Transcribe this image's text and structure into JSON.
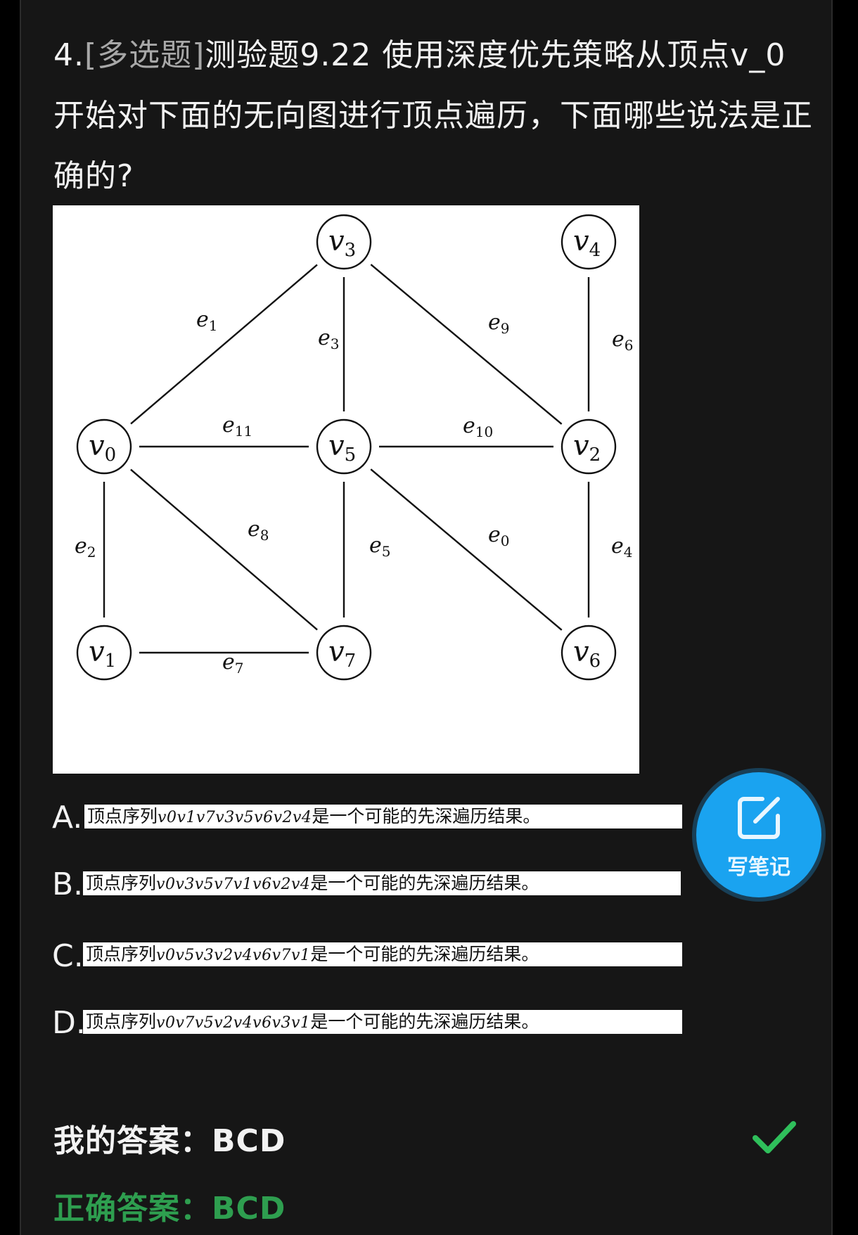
{
  "question": {
    "number": "4.",
    "type": "[多选题]",
    "text": "测验题9.22 使用深度优先策略从顶点v_0开始对下面的无向图进行顶点遍历，下面哪些说法是正确的?"
  },
  "graph": {
    "vertices": [
      "v0",
      "v1",
      "v2",
      "v3",
      "v4",
      "v5",
      "v6",
      "v7"
    ],
    "edges": [
      {
        "label": "e0",
        "from": "v5",
        "to": "v6"
      },
      {
        "label": "e1",
        "from": "v0",
        "to": "v3"
      },
      {
        "label": "e2",
        "from": "v0",
        "to": "v1"
      },
      {
        "label": "e3",
        "from": "v3",
        "to": "v5"
      },
      {
        "label": "e4",
        "from": "v2",
        "to": "v6"
      },
      {
        "label": "e5",
        "from": "v5",
        "to": "v7"
      },
      {
        "label": "e6",
        "from": "v4",
        "to": "v2"
      },
      {
        "label": "e7",
        "from": "v1",
        "to": "v7"
      },
      {
        "label": "e8",
        "from": "v0",
        "to": "v7"
      },
      {
        "label": "e9",
        "from": "v3",
        "to": "v2"
      },
      {
        "label": "e10",
        "from": "v5",
        "to": "v2"
      },
      {
        "label": "e11",
        "from": "v0",
        "to": "v5"
      }
    ]
  },
  "options": [
    {
      "letter": "A.",
      "prefix": "顶点序列",
      "sequence": "v0v1v7v3v5v6v2v4",
      "suffix": "是一个可能的先深遍历结果。"
    },
    {
      "letter": "B.",
      "prefix": "顶点序列",
      "sequence": "v0v3v5v7v1v6v2v4",
      "suffix": "是一个可能的先深遍历结果。"
    },
    {
      "letter": "C.",
      "prefix": "顶点序列",
      "sequence": "v0v5v3v2v4v6v7v1",
      "suffix": "是一个可能的先深遍历结果。"
    },
    {
      "letter": "D.",
      "prefix": "顶点序列",
      "sequence": "v0v7v5v2v4v6v3v1",
      "suffix": "是一个可能的先深遍历结果。"
    }
  ],
  "my_answer": {
    "label": "我的答案：",
    "value": "BCD"
  },
  "correct_answer": {
    "label": "正确答案：",
    "value": "BCD"
  },
  "note_button": {
    "label": "写笔记",
    "icon": "edit-note-icon"
  },
  "colors": {
    "correct": "#2e9e4f",
    "note_button": "#1aa3f0",
    "check": "#2fbf5b"
  }
}
